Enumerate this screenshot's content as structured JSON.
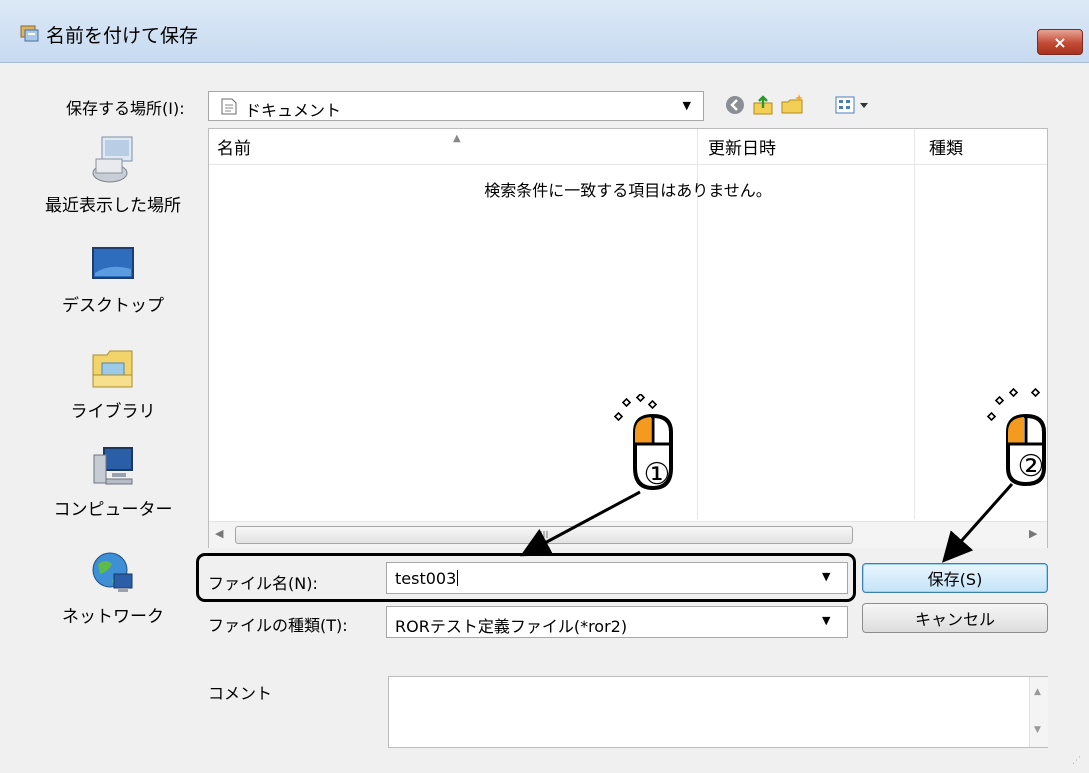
{
  "window": {
    "title": "名前を付けて保存",
    "close_label": "×"
  },
  "location": {
    "label": "保存する場所(I):",
    "value": "ドキュメント"
  },
  "toolbar": {
    "icons": [
      "back-icon",
      "up-folder-icon",
      "new-folder-icon",
      "view-menu-icon"
    ]
  },
  "places": [
    {
      "label": "最近表示した場所",
      "icon": "recent-places-icon"
    },
    {
      "label": "デスクトップ",
      "icon": "desktop-icon"
    },
    {
      "label": "ライブラリ",
      "icon": "library-icon"
    },
    {
      "label": "コンピューター",
      "icon": "computer-icon"
    },
    {
      "label": "ネットワーク",
      "icon": "network-icon"
    }
  ],
  "file_list": {
    "columns": [
      "名前",
      "更新日時",
      "種類"
    ],
    "empty_message": "検索条件に一致する項目はありません。",
    "scroll_thumb_text": "III"
  },
  "form": {
    "filename_label": "ファイル名(N):",
    "filename_value": "test003",
    "filetype_label": "ファイルの種類(T):",
    "filetype_value": "RORテスト定義ファイル(*ror2)",
    "comment_label": "コメント",
    "comment_value": ""
  },
  "buttons": {
    "save": "保存(S)",
    "cancel": "キャンセル"
  },
  "annotations": {
    "step1": "①",
    "step2": "②",
    "accent_color": "#f39a1f"
  }
}
